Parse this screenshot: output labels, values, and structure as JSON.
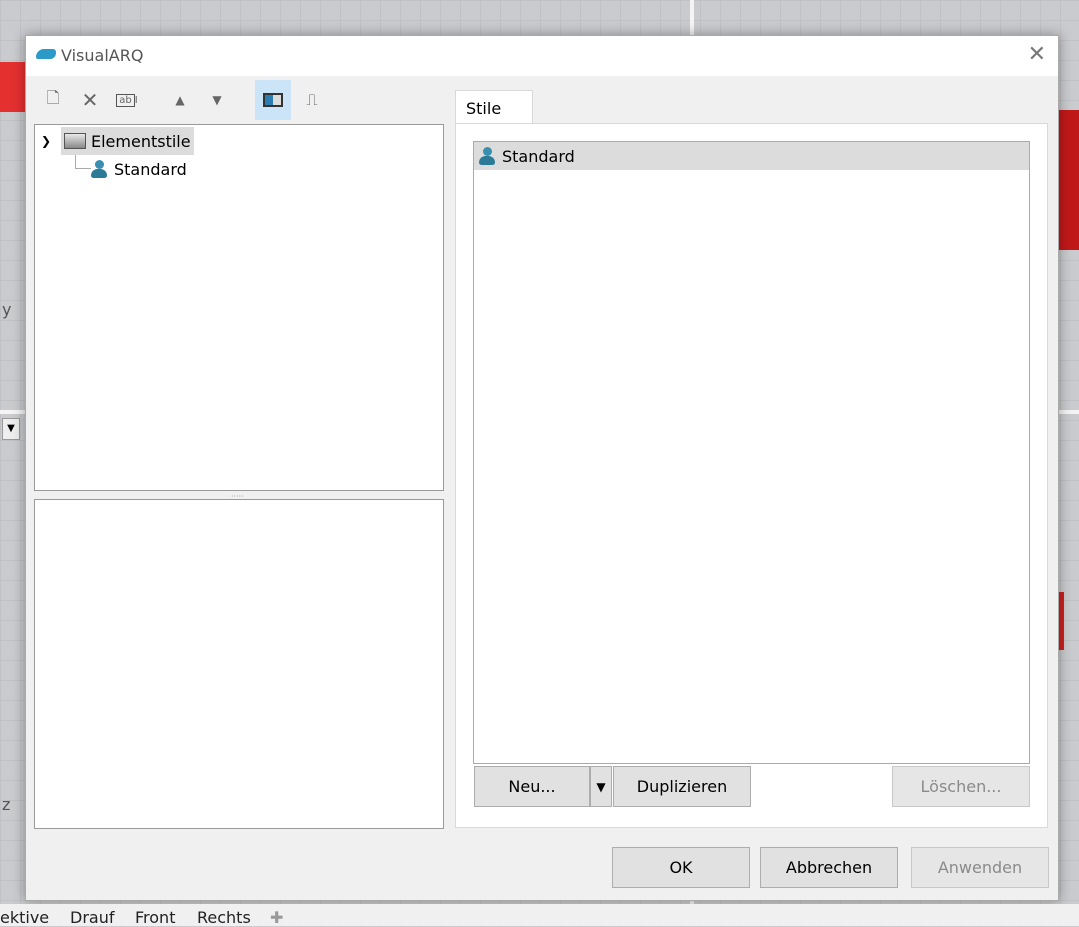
{
  "window": {
    "title": "VisualARQ",
    "close_icon": "close-icon"
  },
  "toolbar": {
    "buttons": [
      "new-icon",
      "delete-icon",
      "rename-icon",
      "move-up-icon",
      "move-down-icon",
      "layout-icon",
      "profile-icon"
    ]
  },
  "tree": {
    "root": "Elementstile",
    "children": [
      "Standard"
    ]
  },
  "tab": {
    "label": "Stile"
  },
  "styles_list": {
    "items": [
      "Standard"
    ]
  },
  "list_buttons": {
    "new": "Neu...",
    "duplicate": "Duplizieren",
    "delete": "Löschen..."
  },
  "dialog_buttons": {
    "ok": "OK",
    "cancel": "Abbrechen",
    "apply": "Anwenden"
  },
  "viewport": {
    "label_y": "y",
    "label_z": "z"
  },
  "viewport_tabs": [
    "ektive",
    "Drauf",
    "Front",
    "Rechts"
  ]
}
